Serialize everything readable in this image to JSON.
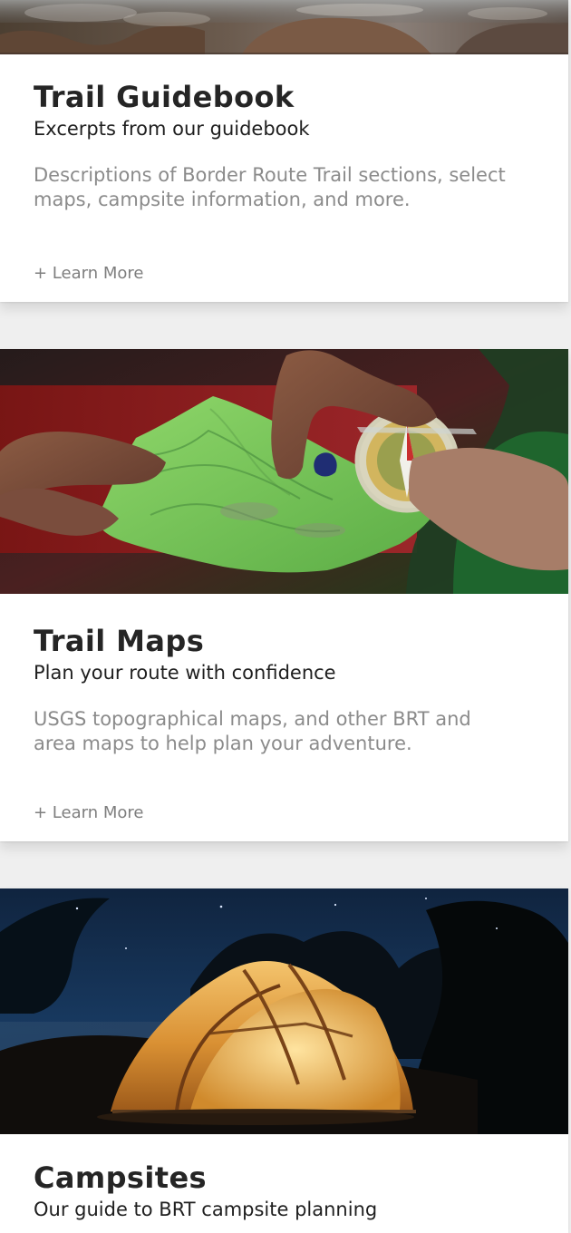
{
  "cards": [
    {
      "title": "Trail Guidebook",
      "subtitle": "Excerpts from our guidebook",
      "description": "Descriptions of Border Route Trail sections, select maps, campsite information, and more.",
      "link_label": "+ Learn More"
    },
    {
      "title": "Trail Maps",
      "subtitle": "Plan your route with confidence",
      "description": "USGS topographical maps, and other BRT and area maps to help plan your adventure.",
      "link_label": "+ Learn More"
    },
    {
      "title": "Campsites",
      "subtitle": "Our guide to BRT campsite planning"
    }
  ]
}
